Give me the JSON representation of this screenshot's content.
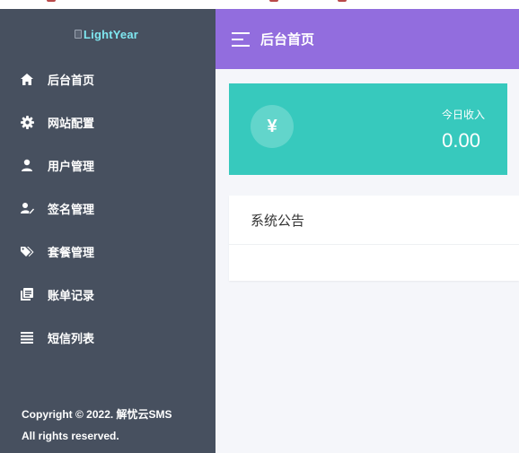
{
  "logo": {
    "alt_text": "LightYear"
  },
  "sidebar": {
    "items": [
      {
        "label": "后台首页",
        "icon": "home-icon"
      },
      {
        "label": "网站配置",
        "icon": "gear-icon"
      },
      {
        "label": "用户管理",
        "icon": "user-icon"
      },
      {
        "label": "签名管理",
        "icon": "signature-icon"
      },
      {
        "label": "套餐管理",
        "icon": "tags-icon"
      },
      {
        "label": "账单记录",
        "icon": "ledger-icon"
      },
      {
        "label": "短信列表",
        "icon": "list-icon"
      }
    ],
    "copyright_line1": "Copyright © 2022. 解忧云SMS",
    "copyright_line2": "All rights reserved."
  },
  "header": {
    "title": "后台首页"
  },
  "stat_card": {
    "symbol": "¥",
    "label": "今日收入",
    "value": "0.00"
  },
  "notice": {
    "title": "系统公告"
  },
  "colors": {
    "sidebar_bg": "#47505f",
    "header_bg": "#926dde",
    "stat_card_bg": "#37c9bd",
    "page_bg": "#f5f6fa"
  }
}
